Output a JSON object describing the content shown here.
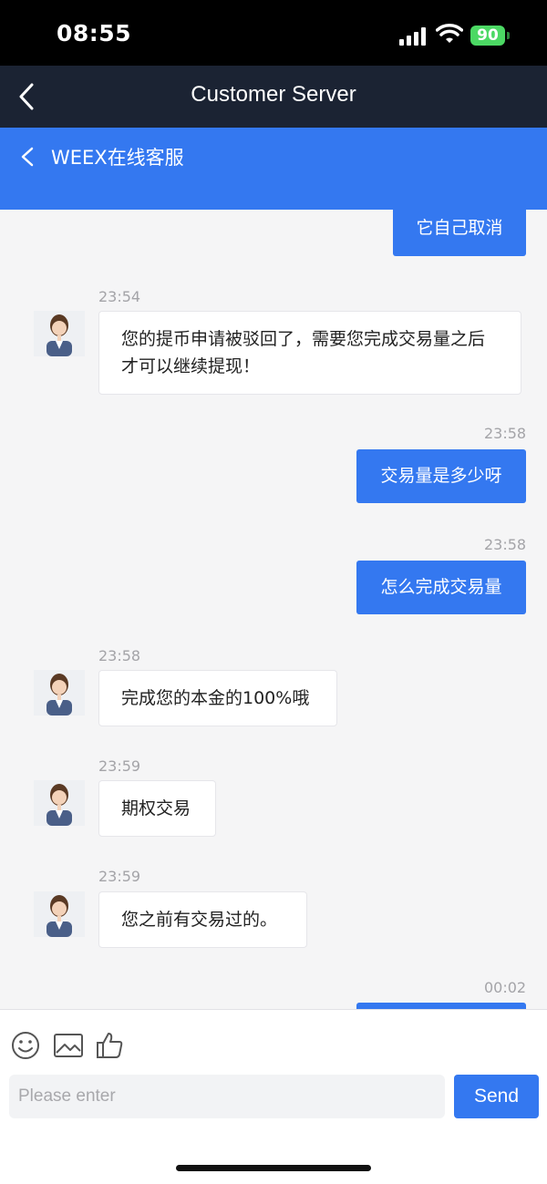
{
  "status_bar": {
    "time": "08:55",
    "battery": "90"
  },
  "header": {
    "title": "Customer Server",
    "back_icon": "chevron-left-icon"
  },
  "subheader": {
    "title": "WEEX在线客服",
    "back_icon": "chevron-left-icon"
  },
  "colors": {
    "accent": "#3478f0",
    "header_bg": "#1b2333",
    "chat_bg": "#f5f5f6"
  },
  "messages": [
    {
      "side": "out",
      "text": "它自己取消"
    },
    {
      "side": "in",
      "time": "23:54",
      "text": "您的提币申请被驳回了，需要您完成交易量之后才可以继续提现！"
    },
    {
      "side": "out",
      "time": "23:58",
      "text": "交易量是多少呀"
    },
    {
      "side": "out",
      "time": "23:58",
      "text": "怎么完成交易量"
    },
    {
      "side": "in",
      "time": "23:58",
      "text": "完成您的本金的100%哦"
    },
    {
      "side": "in",
      "time": "23:59",
      "text": "期权交易"
    },
    {
      "side": "in",
      "time": "23:59",
      "text": "您之前有交易过的。"
    },
    {
      "side": "out",
      "time": "00:02",
      "text": ""
    }
  ],
  "toolbar": {
    "icons": [
      "smiley-icon",
      "image-icon",
      "thumbs-up-icon"
    ]
  },
  "composer": {
    "placeholder": "Please enter",
    "send_label": "Send"
  }
}
